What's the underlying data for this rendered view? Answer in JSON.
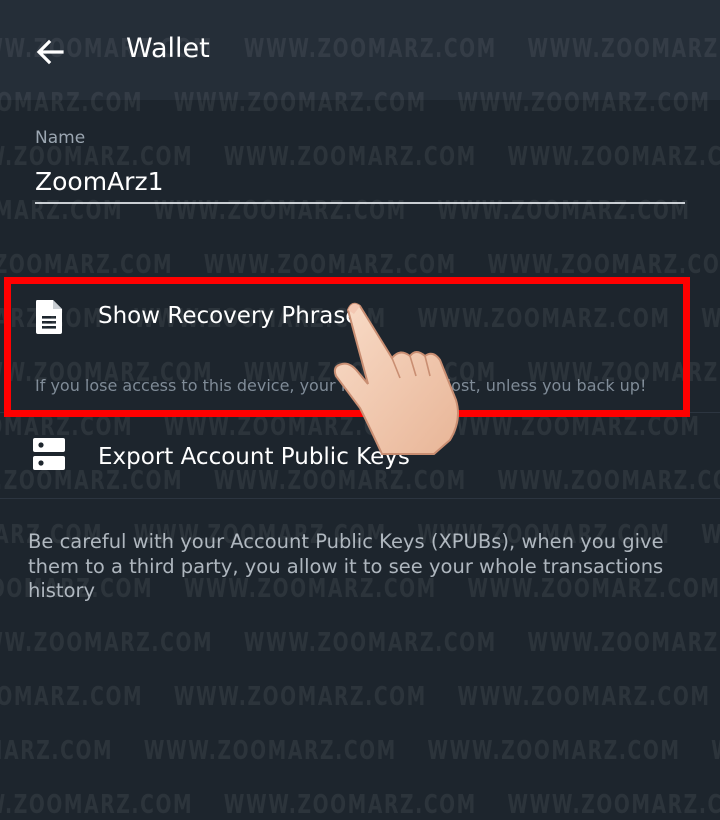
{
  "header": {
    "title": "Wallet",
    "back_icon": "arrow-left-icon"
  },
  "name_field": {
    "label": "Name",
    "value": "ZoomArz1"
  },
  "recovery": {
    "label": "Show Recovery Phrase",
    "icon": "document-icon",
    "hint": "If you lose access to this device, your funds will be lost, unless you back up!"
  },
  "export": {
    "label": "Export Account Public Keys",
    "icon": "server-icon",
    "description": "Be careful with your Account Public Keys (XPUBs), when you give them to a third party, you allow it to see your whole transactions history"
  },
  "watermark": {
    "text": "WWW.ZOOMARZ.COM"
  },
  "colors": {
    "background": "#1d252d",
    "appbar": "#252e38",
    "highlight": "#ff0000",
    "hint_text": "#7f8b97"
  }
}
